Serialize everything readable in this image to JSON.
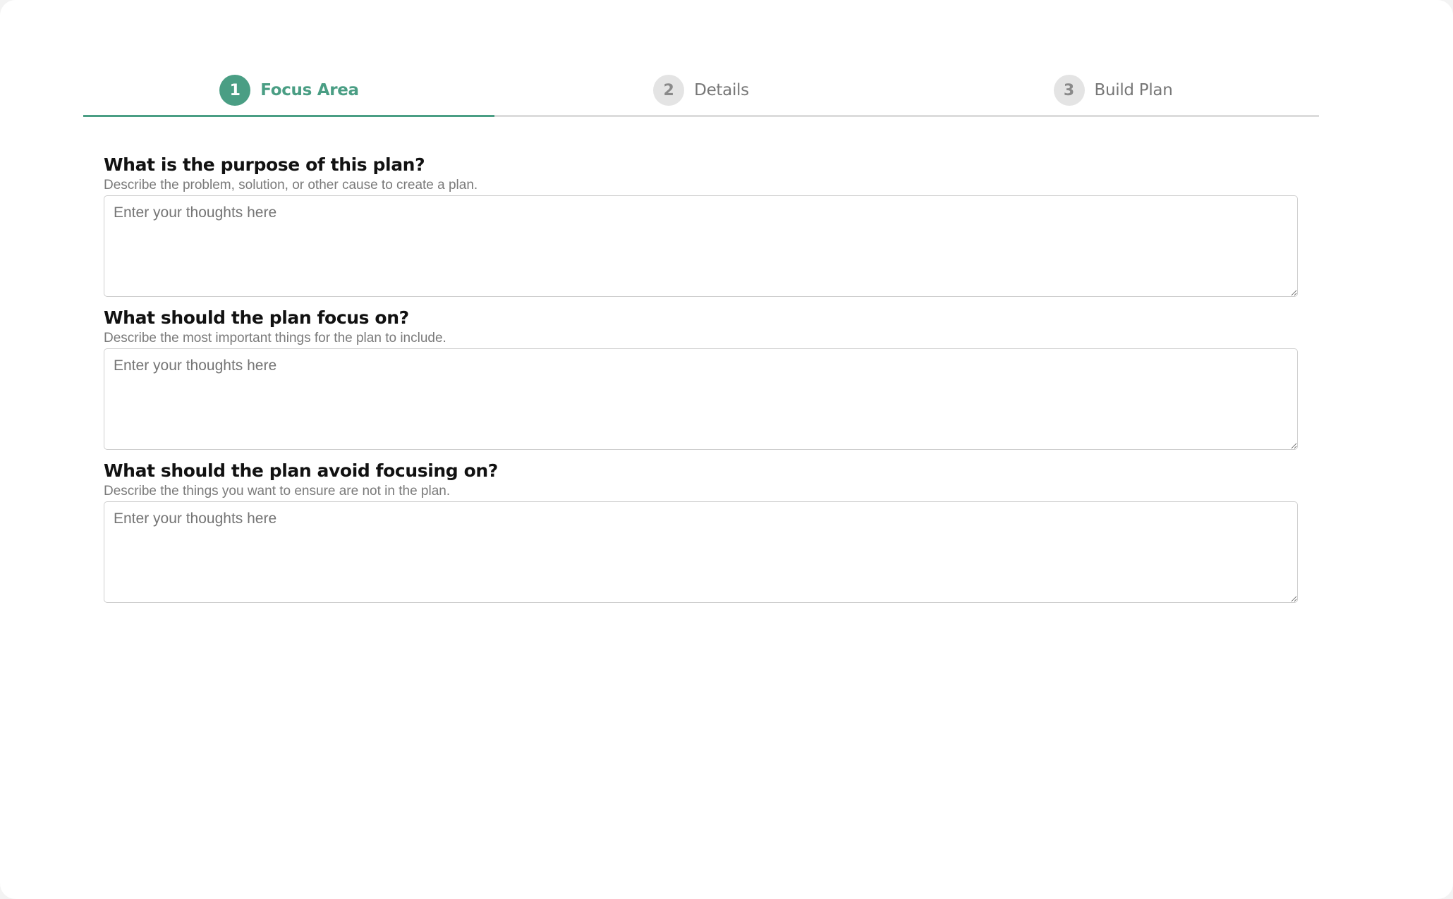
{
  "stepper": {
    "steps": [
      {
        "number": "1",
        "label": "Focus Area",
        "active": true
      },
      {
        "number": "2",
        "label": "Details",
        "active": false
      },
      {
        "number": "3",
        "label": "Build Plan",
        "active": false
      }
    ],
    "accent_color": "#4a9e84",
    "progress_fraction": 0.333
  },
  "form": {
    "fields": [
      {
        "title": "What is the purpose of this plan?",
        "description": "Describe the problem, solution, or other cause to create a plan.",
        "placeholder": "Enter your thoughts here",
        "value": ""
      },
      {
        "title": "What should the plan focus on?",
        "description": "Describe the most important things for the plan to include.",
        "placeholder": "Enter your thoughts here",
        "value": ""
      },
      {
        "title": "What should the plan avoid focusing on?",
        "description": "Describe the things you want to ensure are not in the plan.",
        "placeholder": "Enter your thoughts here",
        "value": ""
      }
    ]
  }
}
